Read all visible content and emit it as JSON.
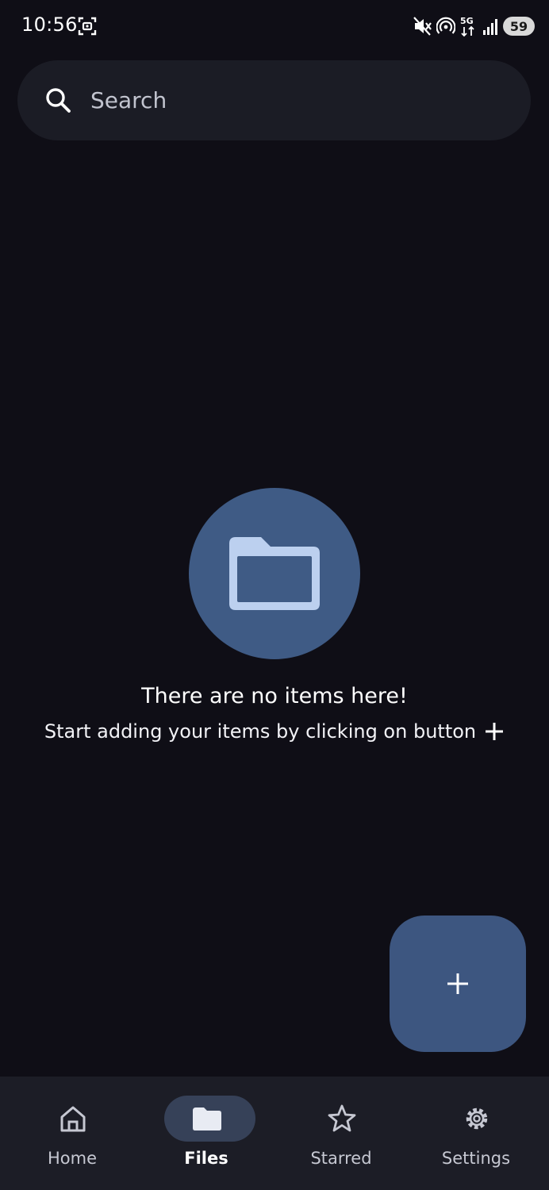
{
  "status_bar": {
    "time": "10:56",
    "battery": "59",
    "network": "5G"
  },
  "search": {
    "placeholder": "Search"
  },
  "empty_state": {
    "title": "There are no items here!",
    "subtitle": "Start adding your items by clicking on button"
  },
  "bottom_nav": {
    "items": [
      {
        "label": "Home",
        "icon": "home-icon",
        "active": false
      },
      {
        "label": "Files",
        "icon": "folder-icon",
        "active": true
      },
      {
        "label": "Starred",
        "icon": "star-icon",
        "active": false
      },
      {
        "label": "Settings",
        "icon": "gear-icon",
        "active": false
      }
    ]
  },
  "colors": {
    "background": "#0f0e16",
    "surface": "#1b1c25",
    "accent": "#3f5b85",
    "accent_light": "#bcd0ef",
    "nav_indicator": "#364158"
  }
}
